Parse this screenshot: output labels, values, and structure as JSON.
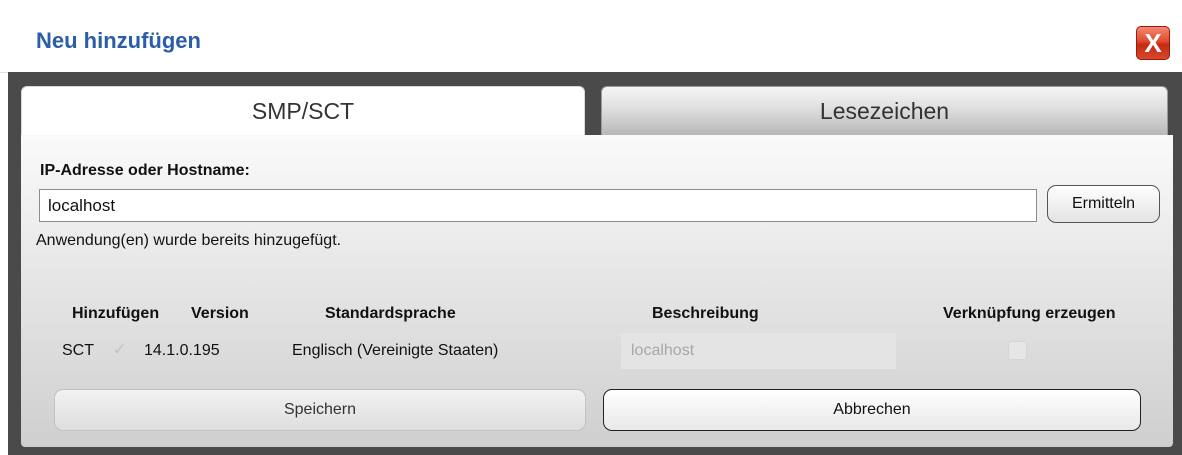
{
  "dialog": {
    "title": "Neu hinzufügen",
    "close_symbol": "X",
    "close_icon": "close-icon"
  },
  "tabs": [
    {
      "label": "SMP/SCT",
      "active": true
    },
    {
      "label": "Lesezeichen",
      "active": false
    }
  ],
  "form": {
    "host_label": "IP-Adresse oder Hostname:",
    "host_value": "localhost",
    "resolve_button": "Ermitteln",
    "status_message": "Anwendung(en) wurde bereits hinzugefügt."
  },
  "table": {
    "headers": [
      "Hinzufügen",
      "Version",
      "Standardsprache",
      "Beschreibung",
      "Verknüpfung erzeugen"
    ],
    "rows": [
      {
        "name": "SCT",
        "add_checked": true,
        "add_enabled": false,
        "check_symbol": "✓",
        "version": "14.1.0.195",
        "language": "Englisch (Vereinigte Staaten)",
        "description": "localhost",
        "description_enabled": false,
        "shortcut_checked": false,
        "shortcut_enabled": false
      }
    ]
  },
  "buttons": {
    "save": "Speichern",
    "save_enabled": false,
    "cancel": "Abbrechen"
  },
  "colors": {
    "title": "#2a5ea8",
    "close_button": "#d9472d",
    "frame": "#4a4a4a"
  }
}
